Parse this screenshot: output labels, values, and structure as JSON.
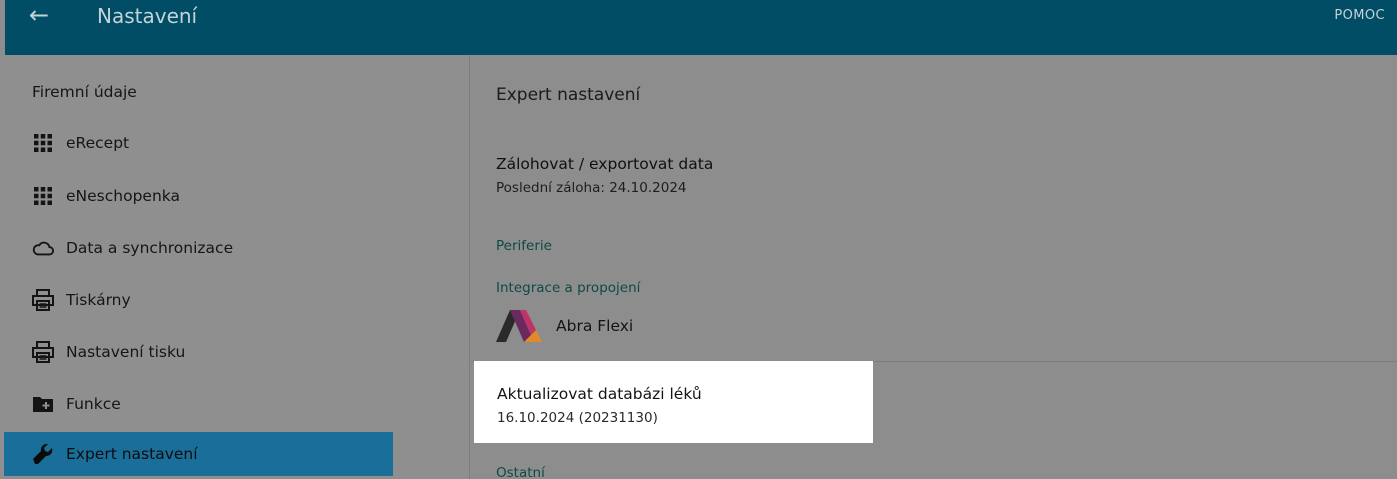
{
  "header": {
    "back_icon": "arrow-left-icon",
    "title": "Nastavení",
    "help_label": "POMOC"
  },
  "sidebar": {
    "items": [
      {
        "label": "Firemní údaje",
        "icon": ""
      },
      {
        "label": "eRecept",
        "icon": "grid-icon"
      },
      {
        "label": "eNeschopenka",
        "icon": "grid-icon"
      },
      {
        "label": "Data a synchronizace",
        "icon": "cloud-icon"
      },
      {
        "label": "Tiskárny",
        "icon": "printer-icon"
      },
      {
        "label": "Nastavení tisku",
        "icon": "printer-icon"
      },
      {
        "label": "Funkce",
        "icon": "folder-plus-icon"
      },
      {
        "label": "Expert nastavení",
        "icon": "wrench-icon",
        "active": true
      }
    ]
  },
  "main": {
    "heading": "Expert nastavení",
    "backup": {
      "title": "Zálohovat / exportovat data",
      "subtitle": "Poslední záloha: 24.10.2024"
    },
    "section_periferie": "Periferie",
    "section_integrace": "Integrace a propojení",
    "integration_item": "Abra Flexi",
    "drug_db": {
      "title": "Aktualizovat databázi léků",
      "subtitle": "16.10.2024 (20231130)"
    },
    "section_ostatni": "Ostatní"
  },
  "colors": {
    "topbar": "#004d65",
    "active_item": "#1a6f9a",
    "section_text": "#0e4a43",
    "overlay_gray": "#8d8d8d"
  }
}
